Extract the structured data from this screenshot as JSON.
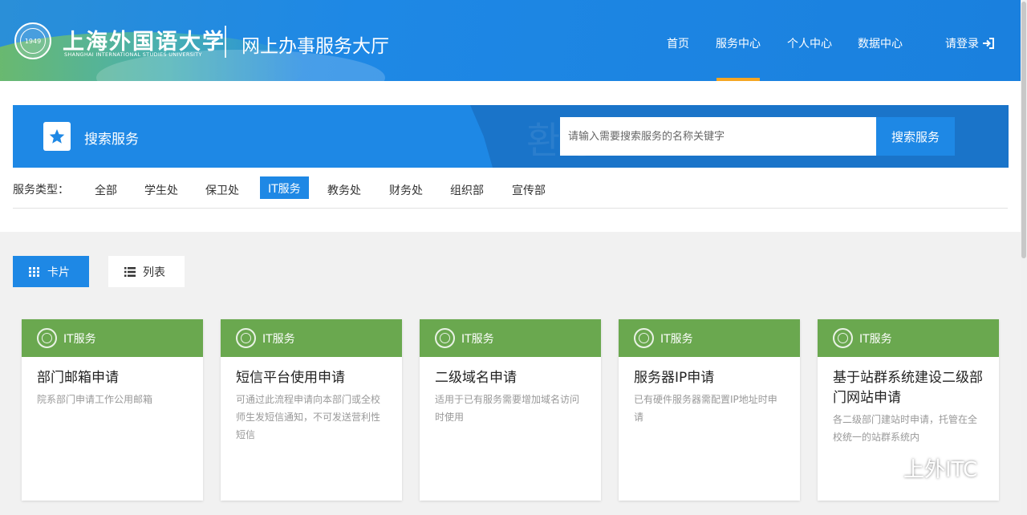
{
  "header": {
    "university_name": "上海外国语大学",
    "university_name_en": "SHANGHAI INTERNATIONAL STUDIES UNIVERSITY",
    "seal_year": "1949",
    "site_title": "网上办事服务大厅",
    "nav": [
      "首页",
      "服务中心",
      "个人中心",
      "数据中心"
    ],
    "active_nav": "服务中心",
    "login_label": "请登录"
  },
  "search": {
    "banner_label": "搜索服务",
    "placeholder": "请输入需要搜索服务的名称关键字",
    "button_label": "搜索服务"
  },
  "filter": {
    "label": "服务类型：",
    "types": [
      "全部",
      "学生处",
      "保卫处",
      "IT服务",
      "教务处",
      "财务处",
      "组织部",
      "宣传部"
    ],
    "active": "IT服务"
  },
  "view_toggle": {
    "card_label": "卡片",
    "list_label": "列表",
    "active": "卡片"
  },
  "cards": [
    {
      "tag": "IT服务",
      "title": "部门邮箱申请",
      "desc": "院系部门申请工作公用邮箱"
    },
    {
      "tag": "IT服务",
      "title": "短信平台使用申请",
      "desc": "可通过此流程申请向本部门或全校师生发短信通知，不可发送营利性短信"
    },
    {
      "tag": "IT服务",
      "title": "二级域名申请",
      "desc": "适用于已有服务需要增加域名访问时使用"
    },
    {
      "tag": "IT服务",
      "title": "服务器IP申请",
      "desc": "已有硬件服务器需配置IP地址时申请"
    },
    {
      "tag": "IT服务",
      "title": "基于站群系统建设二级部门网站申请",
      "desc": "各二级部门建站时申请，托管在全校统一的站群系统内"
    }
  ],
  "watermark": "上外ITC",
  "colors": {
    "primary": "#1e88e5",
    "card_header": "#6aa84f",
    "nav_active": "#f5a623"
  }
}
